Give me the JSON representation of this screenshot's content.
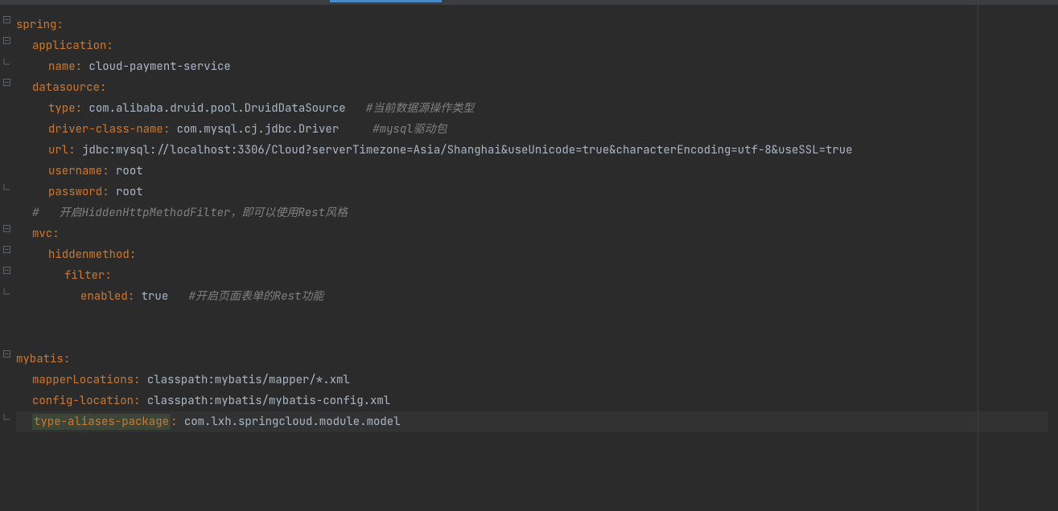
{
  "code": {
    "springKey": "spring",
    "applicationKey": "application",
    "nameKey": "name",
    "nameVal": "cloud-payment-service",
    "datasourceKey": "datasource",
    "typeKey": "type",
    "typeVal": "com.alibaba.druid.pool.DruidDataSource",
    "typeComment": "#当前数据源操作类型",
    "driverKey": "driver-class-name",
    "driverVal": "com.mysql.cj.jdbc.Driver",
    "driverComment": "#mysql驱动包",
    "urlKey": "url",
    "urlVal": "jdbc:mysql://localhost:3306/Cloud?serverTimezone=Asia/Shanghai&useUnicode=true&characterEncoding=utf-8&useSSL=true",
    "usernameKey": "username",
    "usernameVal": "root",
    "passwordKey": "password",
    "passwordVal": "root",
    "hiddenComment": "#   开启HiddenHttpMethodFilter，即可以使用Rest风格",
    "mvcKey": "mvc",
    "hiddenmethodKey": "hiddenmethod",
    "filterKey": "filter",
    "enabledKey": "enabled",
    "enabledVal": "true",
    "enabledComment": "#开启页面表单的Rest功能",
    "mybatisKey": "mybatis",
    "mapperLocKey": "mapperLocations",
    "mapperLocVal": "classpath:mybatis/mapper/*.xml",
    "configLocKey": "config-location",
    "configLocVal": "classpath:mybatis/mybatis-config.xml",
    "typeAliasKey": "type-aliases-package",
    "typeAliasVal": "com.lxh.springcloud.module.model"
  }
}
